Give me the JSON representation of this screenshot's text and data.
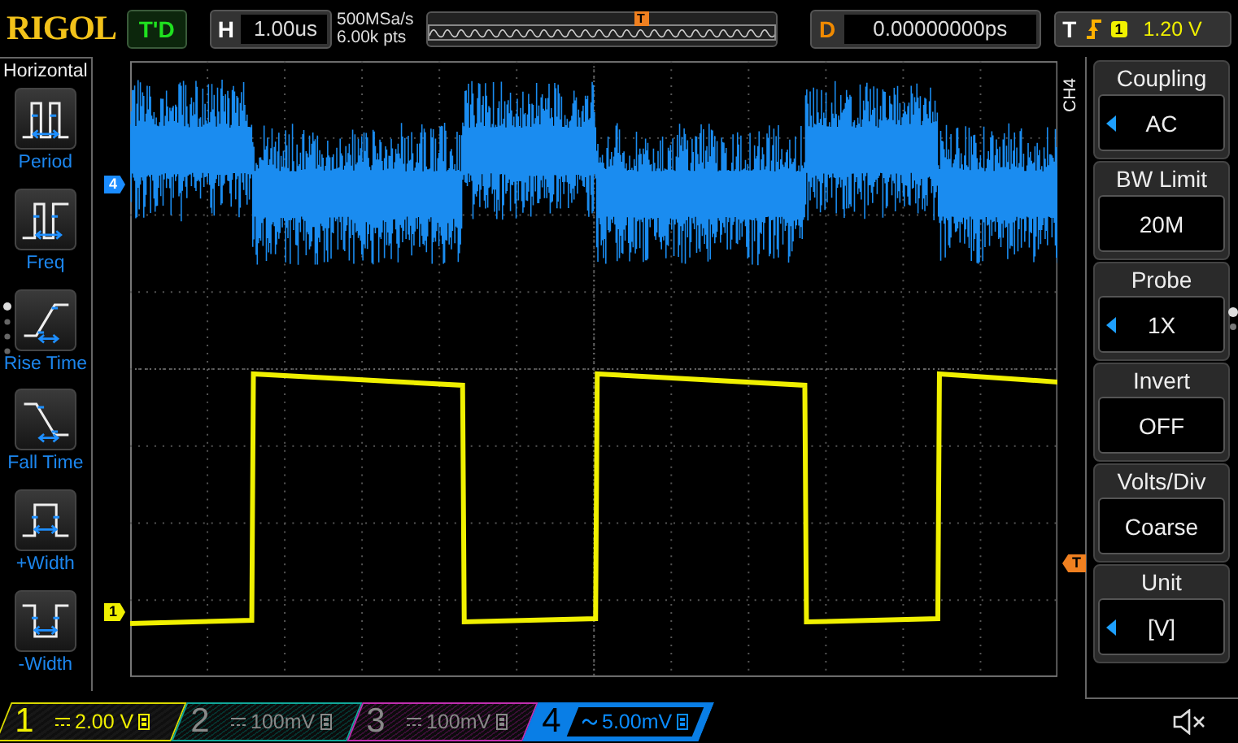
{
  "top_bar": {
    "logo": "RIGOL",
    "run_status": "T'D",
    "timebase": {
      "label": "H",
      "value": "1.00us"
    },
    "sample_rate": "500MSa/s",
    "memory_depth": "6.00k pts",
    "trigger_position_marker": "T",
    "delay": {
      "label": "D",
      "value": "0.00000000ps"
    },
    "trigger": {
      "label": "T",
      "source": "1",
      "level": "1.20 V"
    }
  },
  "horizontal_menu": {
    "title": "Horizontal",
    "items": [
      {
        "label": "Period",
        "kind": "period"
      },
      {
        "label": "Freq",
        "kind": "freq"
      },
      {
        "label": "Rise Time",
        "kind": "rise"
      },
      {
        "label": "Fall Time",
        "kind": "fall"
      },
      {
        "label": "+Width",
        "kind": "pwidth"
      },
      {
        "label": "-Width",
        "kind": "nwidth"
      }
    ]
  },
  "waveform_markers": {
    "channel_4": "4",
    "channel_1": "1",
    "trigger_level": "T"
  },
  "channel_menu": {
    "tab": "CH4",
    "items": [
      {
        "label": "Coupling",
        "value": "AC",
        "kind": "choice"
      },
      {
        "label": "BW Limit",
        "value": "20M",
        "kind": "plain"
      },
      {
        "label": "Probe",
        "value": "1X",
        "kind": "choice"
      },
      {
        "label": "Invert",
        "value": "OFF",
        "kind": "plain"
      },
      {
        "label": "Volts/Div",
        "value": "Coarse",
        "kind": "plain"
      },
      {
        "label": "Unit",
        "value": "[V]",
        "kind": "choice"
      }
    ]
  },
  "channels": [
    {
      "number": "1",
      "kind": "dc",
      "scale": "2.00 V",
      "enabled": true,
      "selected": false,
      "color": "#f0f000"
    },
    {
      "number": "2",
      "kind": "dc",
      "scale": "100mV",
      "enabled": false,
      "selected": false,
      "color": "#12a89a"
    },
    {
      "number": "3",
      "kind": "dc",
      "scale": "100mV",
      "enabled": false,
      "selected": false,
      "color": "#c030b0"
    },
    {
      "number": "4",
      "kind": "ac",
      "scale": "5.00mV",
      "enabled": true,
      "selected": true,
      "color": "#0a8cff"
    }
  ]
}
